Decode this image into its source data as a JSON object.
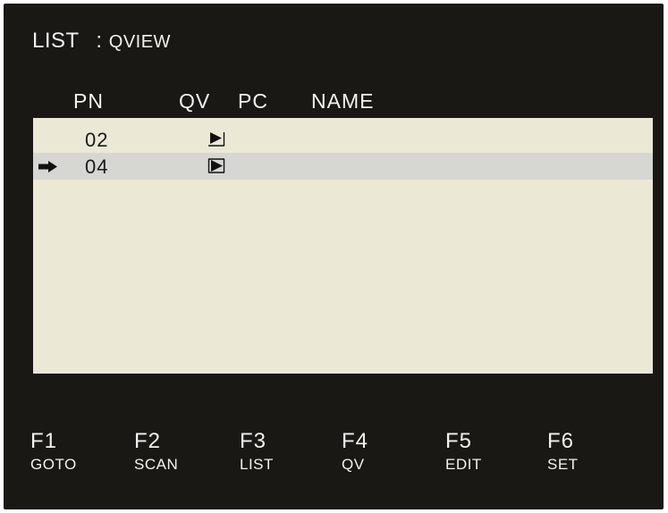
{
  "header": {
    "screen_name": "LIST",
    "separator": ":",
    "mode": "QVIEW"
  },
  "columns": [
    "PN",
    "QV",
    "PC",
    "NAME"
  ],
  "rows": [
    {
      "pn": "02",
      "qv": true,
      "pc": "",
      "name": "",
      "selected": false
    },
    {
      "pn": "04",
      "qv": true,
      "pc": "",
      "name": "",
      "selected": true
    }
  ],
  "icons": {
    "selection": "right-arrow-icon",
    "quick_view": "play-triangle-icon"
  },
  "function_keys": [
    {
      "key": "F1",
      "label": "GOTO"
    },
    {
      "key": "F2",
      "label": "SCAN"
    },
    {
      "key": "F3",
      "label": "LIST"
    },
    {
      "key": "F4",
      "label": "QV"
    },
    {
      "key": "F5",
      "label": "EDIT"
    },
    {
      "key": "F6",
      "label": "SET"
    }
  ],
  "colors": {
    "screen_bg": "#1a1815",
    "text": "#f2f2ee",
    "list_bg": "#ebe8d6",
    "selected_row_bg": "#d6d6d3"
  }
}
